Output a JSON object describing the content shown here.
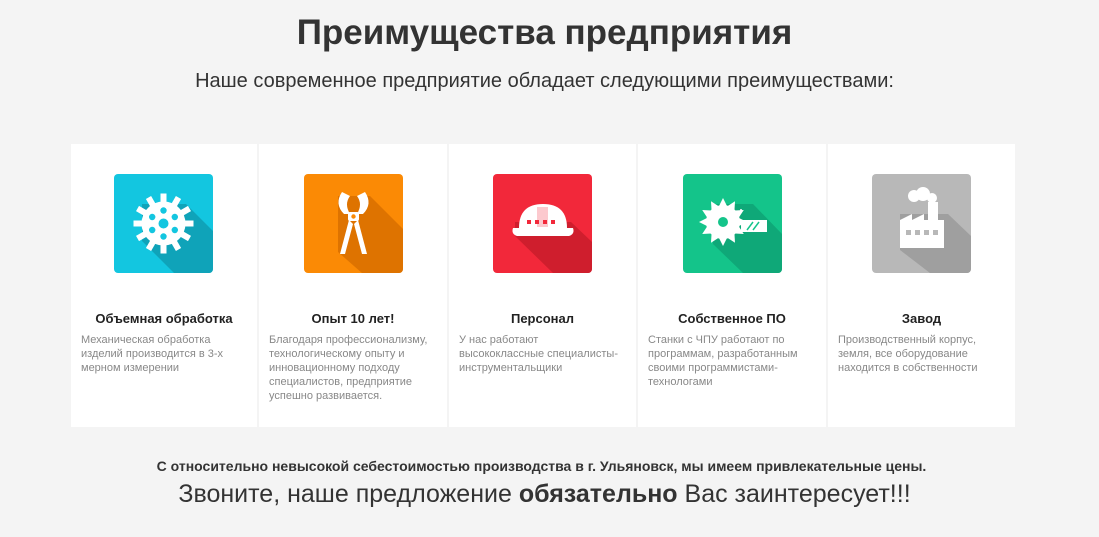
{
  "header": {
    "title": "Преимущества предприятия",
    "subtitle": "Наше современное предприятие обладает следующими преимуществами:"
  },
  "cards": [
    {
      "title": "Объемная обработка",
      "desc": "Механическая обработка изделий производится в 3-х мерном измерении",
      "icon": "snowflake-icon",
      "color": "#13c6e0"
    },
    {
      "title": "Опыт 10 лет!",
      "desc": "Благодаря профессионализму, технологическому опыту и инновационному подходу специалистов, предприятие успешно развивается.",
      "icon": "pliers-icon",
      "color": "#fb8a05"
    },
    {
      "title": "Персонал",
      "desc": "У нас работают высококлассные специалисты-инструментальщики",
      "icon": "hard-hat-icon",
      "color": "#f2283a"
    },
    {
      "title": "Собственное ПО",
      "desc": "Станки с ЧПУ работают по программам, разработанным своими программистами-технологами",
      "icon": "saw-blade-icon",
      "color": "#14c48a"
    },
    {
      "title": "Завод",
      "desc": "Производственный корпус, земля, все оборудование находится в собственности",
      "icon": "factory-icon",
      "color": "#b8b8b8"
    }
  ],
  "footer": {
    "line1": "С относительно невысокой себестоимостью производства в г. Ульяновск, мы имеем привлекательные цены.",
    "line2_before": "Звоните, наше предложение ",
    "line2_bold": "обязательно",
    "line2_after": " Вас заинтересует!!!"
  }
}
